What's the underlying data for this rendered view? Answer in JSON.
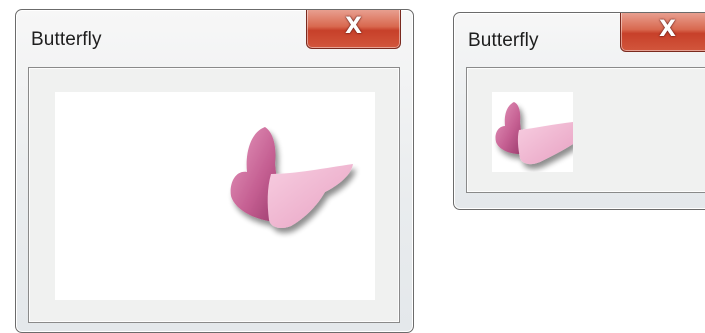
{
  "windows": [
    {
      "title": "Butterfly",
      "close_label": "X",
      "content_image": "butterfly-image"
    },
    {
      "title": "Butterfly",
      "close_label": "X",
      "content_image": "butterfly-image-cropped"
    }
  ],
  "colors": {
    "close_button": "#d2563c",
    "wing_dark": "#c05b8d",
    "wing_light": "#f2b6d2",
    "client_background": "#f0f1f0"
  }
}
